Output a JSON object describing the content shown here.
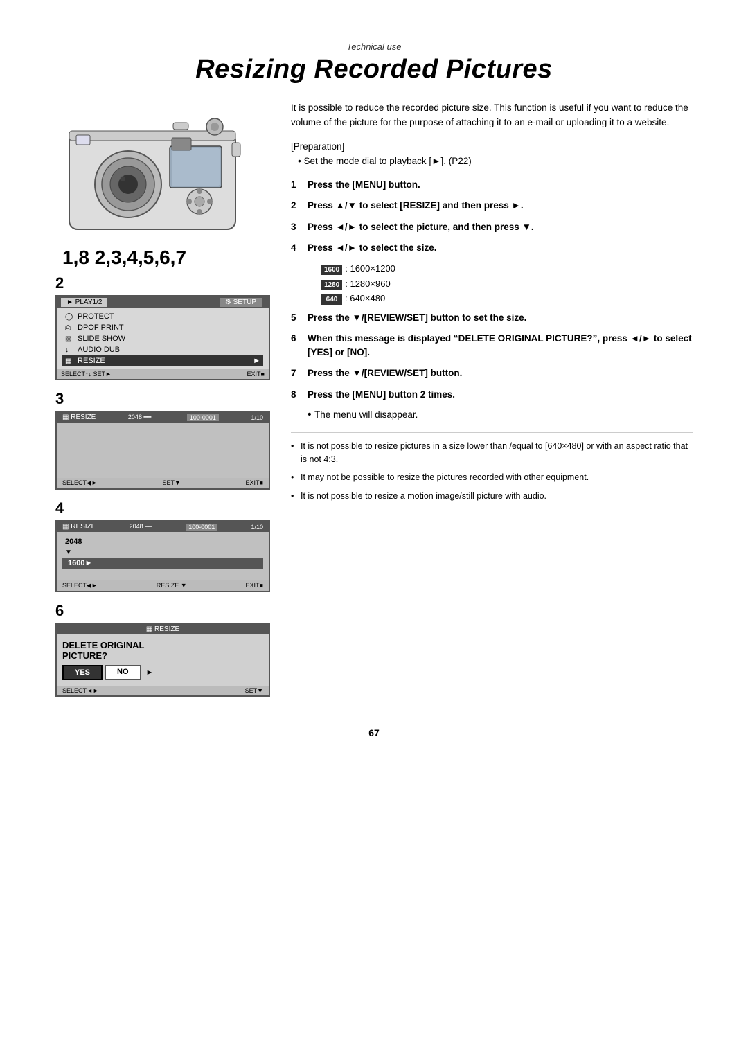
{
  "page": {
    "technical_use": "Technical use",
    "title": "Resizing Recorded Pictures",
    "page_number": "67"
  },
  "intro": {
    "text": "It is possible to reduce the recorded picture size. This function is useful if you want to reduce the volume of the picture for the purpose of attaching it to an e-mail or uploading it to a website.",
    "preparation_label": "[Preparation]",
    "preparation_bullet": "Set the mode dial to playback [►]. (P22)"
  },
  "steps": [
    {
      "num": "1",
      "text": "Press the [MENU] button.",
      "bold": true
    },
    {
      "num": "2",
      "text": "Press ▲/▼ to select [RESIZE] and then press ►.",
      "bold": true
    },
    {
      "num": "3",
      "text": "Press ◄/► to select the picture, and then press ▼.",
      "bold": true
    },
    {
      "num": "4",
      "text": "Press ◄/► to select the size.",
      "bold": true
    },
    {
      "num": "5",
      "text": "Press the ▼/[REVIEW/SET] button to set the size.",
      "bold": true
    },
    {
      "num": "6",
      "text": "When this message is displayed “DELETE ORIGINAL PICTURE?”, press ◄/► to select [YES] or [NO].",
      "bold": true
    },
    {
      "num": "7",
      "text": "Press the ▼/[REVIEW/SET] button.",
      "bold": true
    },
    {
      "num": "8",
      "text": "Press the [MENU] button 2 times.",
      "bold": true
    }
  ],
  "step8_note": "The menu will disappear.",
  "size_options": [
    {
      "badge": "1600",
      "text": ": 1600×1200"
    },
    {
      "badge": "1280",
      "text": ": 1280×960"
    },
    {
      "badge": "640",
      "text": ":  640×480"
    }
  ],
  "notes": [
    "It is not possible to resize pictures in a size lower than /equal to [640×480] or with an aspect ratio that is not 4:3.",
    "It may not be possible to resize the pictures recorded with other equipment.",
    "It is not possible to resize a motion image/still picture with audio."
  ],
  "screens": {
    "screen2": {
      "header_left": "► PLAY1/2",
      "header_right": "⚙ SETUP",
      "items": [
        {
          "icon": "ⓞ",
          "label": "PROTECT",
          "selected": false
        },
        {
          "icon": "⎙",
          "label": "DPOF PRINT",
          "selected": false
        },
        {
          "icon": "▣",
          "label": "SLIDE SHOW",
          "selected": false
        },
        {
          "icon": "↓",
          "label": "AUDIO DUB",
          "selected": false
        },
        {
          "icon": "↩",
          "label": "RESIZE",
          "selected": true
        }
      ],
      "footer": [
        "SELECT↑↓ SET►",
        "EXIT■"
      ]
    },
    "screen3": {
      "header_icon": "↩ RESIZE",
      "info": "2048 ≡≡  100-0001  1/10",
      "footer_left": "SELECT◄►",
      "footer_center": "SET▼",
      "footer_right": "EXIT■"
    },
    "screen4": {
      "header_icon": "↩ RESIZE",
      "info": "2048 ≡≡  100-0001  1/10",
      "sizes": [
        "2048",
        "▼",
        "1600►"
      ],
      "footer_left": "SELECT◄►",
      "footer_center": "RESIZE ▼",
      "footer_right": "EXIT■"
    },
    "screen6": {
      "header": "↩ RESIZE",
      "line1": "DELETE ORIGINAL",
      "line2": "PICTURE?",
      "yes": "YES",
      "no": "NO",
      "footer_left": "SELECT◄►",
      "footer_right": "SET▼"
    }
  },
  "step_labels": {
    "s1_8": "1,8  2,3,4,5,6,7",
    "s2": "2",
    "s3": "3",
    "s4": "4",
    "s6": "6"
  }
}
